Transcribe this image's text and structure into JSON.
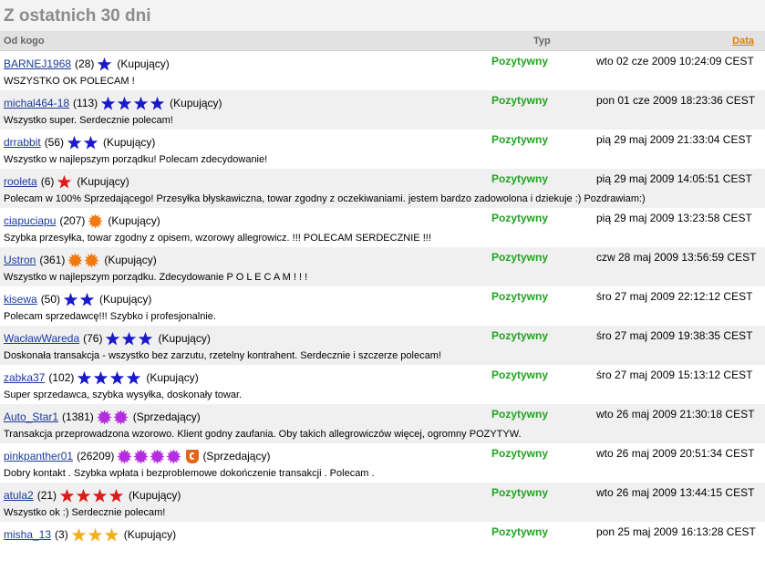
{
  "title": "Z ostatnich 30 dni",
  "header": {
    "from": "Od kogo",
    "type": "Typ",
    "date": "Data"
  },
  "colors": {
    "positive": "#21a321",
    "link": "#1a3a9a",
    "sort_link": "#e87a00",
    "blue_star": "#1a1acc",
    "red_star": "#e01b1b",
    "orange_star": "#f07a10",
    "purple_star": "#b42ee0",
    "gold_star": "#f2b01e"
  },
  "rows": [
    {
      "user": "BARNEJ1968",
      "count": "(28)",
      "icon": "blue-star",
      "icon_count": 1,
      "role": "(Kupujący)",
      "type": "Pozytywny",
      "date": "wto 02 cze 2009 10:24:09 CEST",
      "comment": "WSZYSTKO OK POLECAM !"
    },
    {
      "user": "michal464-18",
      "count": "(113)",
      "icon": "blue-star",
      "icon_count": 4,
      "role": "(Kupujący)",
      "type": "Pozytywny",
      "date": "pon 01 cze 2009 18:23:36 CEST",
      "comment": "Wszystko super. Serdecznie polecam!"
    },
    {
      "user": "drrabbit",
      "count": "(56)",
      "icon": "blue-star",
      "icon_count": 2,
      "role": "(Kupujący)",
      "type": "Pozytywny",
      "date": "pią 29 maj 2009 21:33:04 CEST",
      "comment": "Wszystko w najlepszym porządku! Polecam zdecydowanie!"
    },
    {
      "user": "rooleta",
      "count": "(6)",
      "icon": "red-star",
      "icon_count": 1,
      "role": "(Kupujący)",
      "type": "Pozytywny",
      "date": "pią 29 maj 2009 14:05:51 CEST",
      "comment": "Polecam w 100% Sprzedającego! Przesyłka błyskawiczna, towar zgodny z oczekiwaniami. jestem bardzo zadowolona i dziekuje :) Pozdrawiam:)"
    },
    {
      "user": "ciapuciapu",
      "count": "(207)",
      "icon": "orange-sun",
      "icon_count": 1,
      "role": "(Kupujący)",
      "type": "Pozytywny",
      "date": "pią 29 maj 2009 13:23:58 CEST",
      "comment": "Szybka przesyłka, towar zgodny z opisem, wzorowy allegrowicz. !!! POLECAM SERDECZNIE !!!"
    },
    {
      "user": "Ustron",
      "count": "(361)",
      "icon": "orange-sun",
      "icon_count": 2,
      "role": "(Kupujący)",
      "type": "Pozytywny",
      "date": "czw 28 maj 2009 13:56:59 CEST",
      "comment": "Wszystko w najlepszym porządku. Zdecydowanie P O L E C A M ! ! !"
    },
    {
      "user": "kisewa",
      "count": "(50)",
      "icon": "blue-star",
      "icon_count": 2,
      "role": "(Kupujący)",
      "type": "Pozytywny",
      "date": "śro 27 maj 2009 22:12:12 CEST",
      "comment": "Polecam sprzedawcę!!! Szybko i profesjonalnie."
    },
    {
      "user": "WacławWareda",
      "count": "(76)",
      "icon": "blue-star",
      "icon_count": 3,
      "role": "(Kupujący)",
      "type": "Pozytywny",
      "date": "śro 27 maj 2009 19:38:35 CEST",
      "comment": "Doskonała transakcja - wszystko bez zarzutu, rzetelny kontrahent. Serdecznie i szczerze polecam!"
    },
    {
      "user": "zabka37",
      "count": "(102)",
      "icon": "blue-star",
      "icon_count": 4,
      "role": "(Kupujący)",
      "type": "Pozytywny",
      "date": "śro 27 maj 2009 15:13:12 CEST",
      "comment": "Super sprzedawca, szybka wysyłka, doskonały towar."
    },
    {
      "user": "Auto_Star1",
      "count": "(1381)",
      "icon": "purple-sun",
      "icon_count": 2,
      "role": "(Sprzedający)",
      "type": "Pozytywny",
      "date": "wto 26 maj 2009 21:30:18 CEST",
      "comment": "Transakcja przeprowadzona wzorowo. Klient godny zaufania. Oby takich allegrowiczów więcej, ogromny POZYTYW."
    },
    {
      "user": "pinkpanther01",
      "count": "(26209)",
      "icon": "purple-sun",
      "icon_count": 4,
      "extra_icon": "super-seller-shield-icon",
      "role": "(Sprzedający)",
      "type": "Pozytywny",
      "date": "wto 26 maj 2009 20:51:34 CEST",
      "comment": "Dobry kontakt . Szybka wpłata i bezproblemowe dokończenie transakcji . Polecam ."
    },
    {
      "user": "atula2",
      "count": "(21)",
      "icon": "red-star",
      "icon_count": 4,
      "role": "(Kupujący)",
      "type": "Pozytywny",
      "date": "wto 26 maj 2009 13:44:15 CEST",
      "comment": "Wszystko ok :) Serdecznie polecam!"
    },
    {
      "user": "misha_13",
      "count": "(3)",
      "icon": "gold-star",
      "icon_count": 3,
      "role": "(Kupujący)",
      "type": "Pozytywny",
      "date": "pon 25 maj 2009 16:13:28 CEST",
      "comment": ""
    }
  ]
}
